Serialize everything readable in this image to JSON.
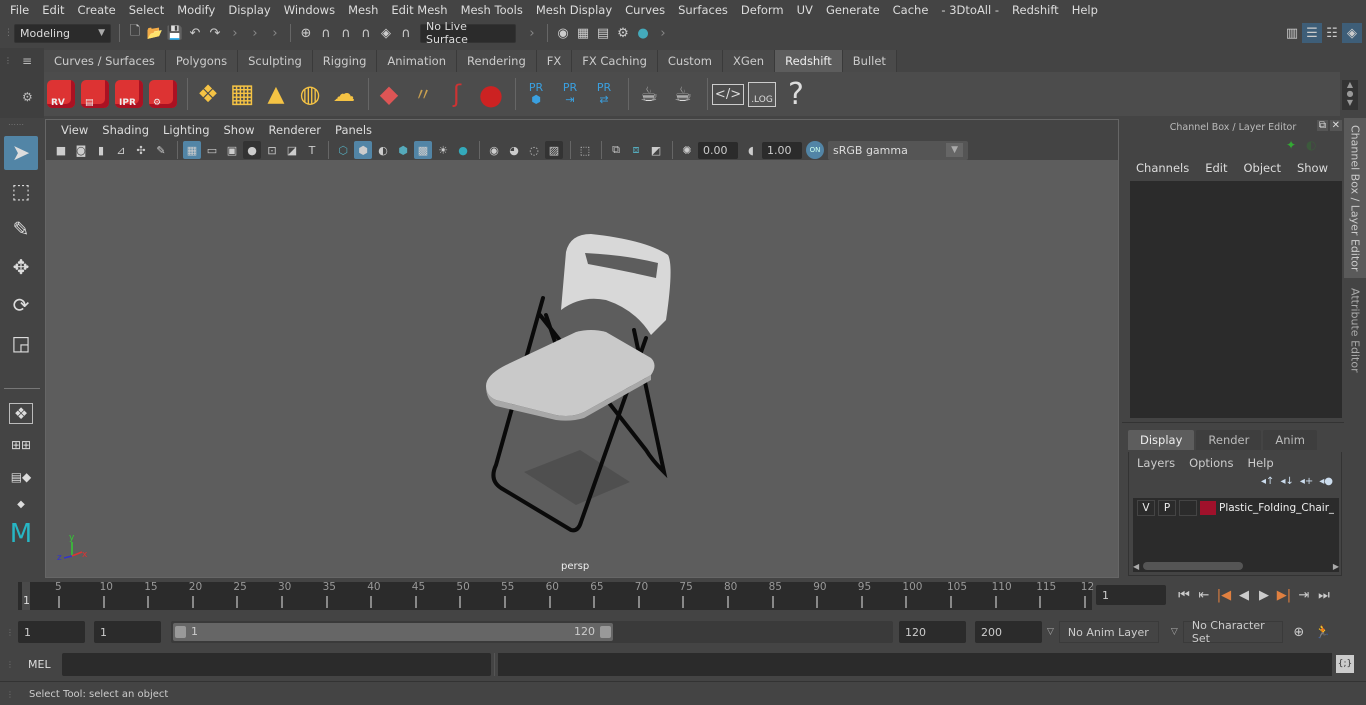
{
  "menubar": {
    "items": [
      "File",
      "Edit",
      "Create",
      "Select",
      "Modify",
      "Display",
      "Windows",
      "Mesh",
      "Edit Mesh",
      "Mesh Tools",
      "Mesh Display",
      "Curves",
      "Surfaces",
      "Deform",
      "UV",
      "Generate",
      "Cache",
      "- 3DtoAll -",
      "Redshift",
      "Help"
    ]
  },
  "statusline": {
    "workspace": "Modeling",
    "live_surface": "No Live Surface"
  },
  "shelf": {
    "tabs": [
      "Curves / Surfaces",
      "Polygons",
      "Sculpting",
      "Rigging",
      "Animation",
      "Rendering",
      "FX",
      "FX Caching",
      "Custom",
      "XGen",
      "Redshift",
      "Bullet"
    ],
    "active_tab": "Redshift",
    "icons": {
      "rv": "RV",
      "ipr": "IPR",
      "pr": "PR",
      "log": ".LOG",
      "help": "?"
    }
  },
  "viewport": {
    "menu": [
      "View",
      "Shading",
      "Lighting",
      "Show",
      "Renderer",
      "Panels"
    ],
    "exposure": "0.00",
    "gamma": "1.00",
    "color_mgmt_toggle": "ON",
    "color_space": "sRGB gamma",
    "camera_label": "persp",
    "axis": {
      "x": "x",
      "y": "y",
      "z": "z"
    }
  },
  "channel_box": {
    "title": "Channel Box / Layer Editor",
    "menu": [
      "Channels",
      "Edit",
      "Object",
      "Show"
    ]
  },
  "layer_editor": {
    "tabs": [
      "Display",
      "Render",
      "Anim"
    ],
    "active_tab": "Display",
    "menu": [
      "Layers",
      "Options",
      "Help"
    ],
    "layers": [
      {
        "v": "V",
        "p": "P",
        "color": "#a0112b",
        "name": "Plastic_Folding_Chair_"
      }
    ]
  },
  "side_tabs": [
    "Channel Box / Layer Editor",
    "Attribute Editor"
  ],
  "timeline": {
    "ticks": [
      "5",
      "10",
      "15",
      "20",
      "25",
      "30",
      "35",
      "40",
      "45",
      "50",
      "55",
      "60",
      "65",
      "70",
      "75",
      "80",
      "85",
      "90",
      "95",
      "100",
      "105",
      "110",
      "115",
      "12"
    ],
    "current_marker": "1",
    "current_frame": "1"
  },
  "range": {
    "start": "1",
    "playback_start": "1",
    "slider_start": "1",
    "slider_end": "120",
    "playback_end": "120",
    "end": "200",
    "anim_layer": "No Anim Layer",
    "character_set": "No Character Set"
  },
  "command": {
    "language": "MEL"
  },
  "help_line": "Select Tool: select an object"
}
